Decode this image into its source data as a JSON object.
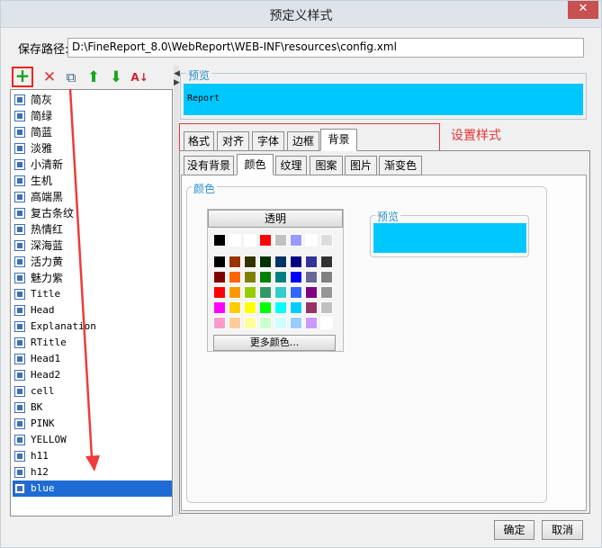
{
  "window": {
    "title": "预定义样式",
    "close": "✕"
  },
  "path": {
    "label": "保存路径:",
    "value": "D:\\FineReport_8.0\\WebReport\\WEB-INF\\resources\\config.xml"
  },
  "toolbar": {
    "add": "+",
    "delete": "✕",
    "copy": "⧉",
    "up": "⬆",
    "down": "⬇",
    "sort": "A↓"
  },
  "styles": [
    "简灰",
    "简绿",
    "简蓝",
    "淡雅",
    "小清新",
    "生机",
    "高端黑",
    "复古条纹",
    "热情红",
    "深海蓝",
    "活力黄",
    "魅力紫",
    "Title",
    "Head",
    "Explanation",
    "RTitle",
    "Head1",
    "Head2",
    "cell",
    "BK",
    "PINK",
    "YELLOW",
    "h11",
    "h12",
    "blue"
  ],
  "selected_style": "blue",
  "preview": {
    "label": "预览",
    "sample_text": "Report",
    "color": "#00c8ff"
  },
  "annotation": {
    "text": "设置样式",
    "color": "#e33333"
  },
  "tabs": [
    {
      "label": "格式"
    },
    {
      "label": "对齐"
    },
    {
      "label": "字体"
    },
    {
      "label": "边框"
    },
    {
      "label": "背景"
    }
  ],
  "active_tab": "背景",
  "subtabs": [
    {
      "label": "没有背景"
    },
    {
      "label": "颜色"
    },
    {
      "label": "纹理"
    },
    {
      "label": "图案"
    },
    {
      "label": "图片"
    },
    {
      "label": "渐变色"
    }
  ],
  "active_subtab": "颜色",
  "color_panel": {
    "label": "颜色",
    "transparent": "透明",
    "more_colors": "更多颜色...",
    "preview_label": "预览",
    "preview_color": "#00c8ff"
  },
  "recent_colors": [
    "#000000",
    "#ffffff",
    "#ffffff",
    "#ff0000",
    "#c0c0c0",
    "#9999ff",
    "#ffffff",
    "#dddddd"
  ],
  "palette": [
    [
      "#000000",
      "#993300",
      "#333300",
      "#003300",
      "#003366",
      "#000080",
      "#333399",
      "#333333"
    ],
    [
      "#800000",
      "#ff6600",
      "#808000",
      "#008000",
      "#008080",
      "#0000ff",
      "#666699",
      "#808080"
    ],
    [
      "#ff0000",
      "#ff9900",
      "#99cc00",
      "#339966",
      "#33cccc",
      "#3366ff",
      "#800080",
      "#969696"
    ],
    [
      "#ff00ff",
      "#ffcc00",
      "#ffff00",
      "#00ff00",
      "#00ffff",
      "#00ccff",
      "#993366",
      "#c0c0c0"
    ],
    [
      "#ff99cc",
      "#ffcc99",
      "#ffff99",
      "#ccffcc",
      "#ccffff",
      "#99ccff",
      "#cc99ff",
      "#ffffff"
    ]
  ],
  "buttons": {
    "ok": "确定",
    "cancel": "取消"
  }
}
